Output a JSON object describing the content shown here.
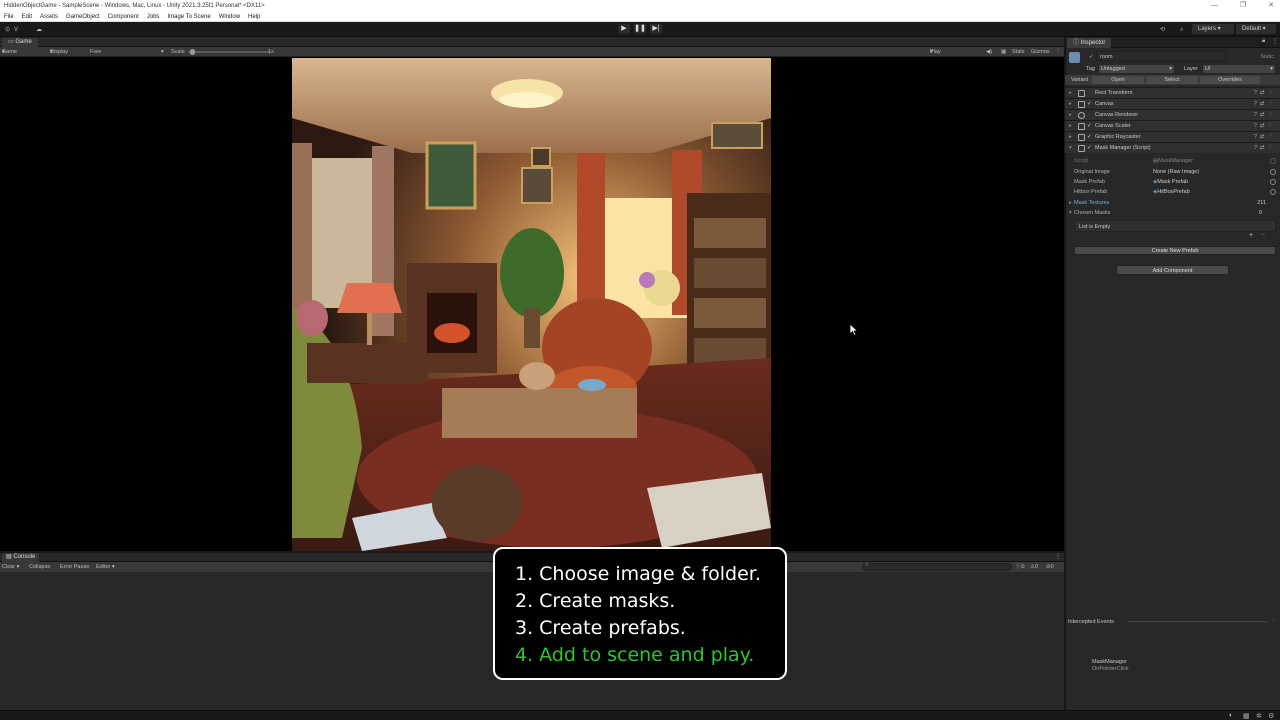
{
  "window": {
    "title": "HiddenObjectGame - SampleScene - Windows, Mac, Linux - Unity 2021.3.25f1 Personal* <DX11>",
    "controls": [
      "—",
      "❐",
      "✕"
    ]
  },
  "menu": [
    "File",
    "Edit",
    "Assets",
    "GameObject",
    "Component",
    "Jobs",
    "Image To Scene",
    "Window",
    "Help"
  ],
  "toolbar": {
    "account_label": "V",
    "layers_label": "Layers",
    "layout_label": "Default"
  },
  "game_panel": {
    "tab_label": "Game",
    "view_mode": "Game",
    "display": "Display 1",
    "aspect": "Free Aspect",
    "scale_label": "Scale",
    "scale_value": "1x",
    "play_focused": "Play Focused",
    "stats": "Stats",
    "gizmos": "Gizmos"
  },
  "inspector": {
    "tab_label": "Inspector",
    "object_name": "room",
    "static_label": "Static",
    "tag_label": "Tag",
    "tag_value": "Untagged",
    "layer_label": "Layer",
    "layer_value": "UI",
    "variant_label": "Variant",
    "open_btn": "Open",
    "select_btn": "Select",
    "overrides_btn": "Overrides",
    "components": [
      {
        "name": "Rect Transform"
      },
      {
        "name": "Canvas"
      },
      {
        "name": "Canvas Renderer"
      },
      {
        "name": "Canvas Scaler"
      },
      {
        "name": "Graphic Raycaster"
      },
      {
        "name": "Mask Manager (Script)"
      }
    ],
    "script_label": "Script",
    "script_value": "MaskManager",
    "fields": [
      {
        "label": "Original Image",
        "value": "None (Raw Image)"
      },
      {
        "label": "Mask Prefab",
        "value": "Mask Prefab"
      },
      {
        "label": "Hitbox Prefab",
        "value": "HitBoxPrefab"
      }
    ],
    "mask_textures_label": "Mask Textures",
    "mask_textures_count": "211",
    "chosen_masks_label": "Chosen Masks",
    "chosen_masks_count": "0",
    "list_empty": "List is Empty",
    "create_prefab_btn": "Create New Prefab",
    "add_component_btn": "Add Component",
    "intercepted_events": "Intercepted Events",
    "event_target": "MaskManager",
    "event_name": "OnPointerClick"
  },
  "console": {
    "tab_label": "Console",
    "clear": "Clear",
    "collapse": "Collapse",
    "error_pause": "Error Pause",
    "editor": "Editor",
    "counts": [
      "0",
      "0",
      "0"
    ]
  },
  "callout": {
    "steps": [
      "1. Choose image & folder.",
      "2. Create masks.",
      "3. Create prefabs.",
      "4. Add to scene and play."
    ],
    "highlight_color": "#2fc42f"
  },
  "colors": {
    "editor_bg": "#282828",
    "toolbar_bg": "#191919",
    "accent_blue": "#3a79bb"
  }
}
